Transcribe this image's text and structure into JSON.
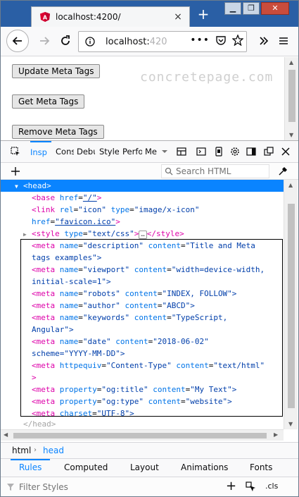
{
  "browser": {
    "tab_title": "localhost:4200/",
    "tab_close": "×",
    "new_tab": "+",
    "url_main": "localhost:",
    "url_faded": "420",
    "window_controls": [
      "▁",
      "❐",
      "✕"
    ],
    "accent": "#0a84ff"
  },
  "page": {
    "buttons": [
      "Update Meta Tags",
      "Get Meta Tags",
      "Remove Meta Tags"
    ],
    "brand_text": "concretepage.com"
  },
  "devtools": {
    "tabs": [
      "Insp",
      "Cons",
      "Debu",
      "Style",
      "Perfo",
      "Me"
    ],
    "search_placeholder": "Search HTML",
    "markup": {
      "head_open": "<head>",
      "head_close": "</head>",
      "base": {
        "tag": "<base",
        "attr": "href",
        "val": "\"/\"",
        "end": ">"
      },
      "link": {
        "tag": "<link",
        "attr1": "rel",
        "val1": "\"icon\"",
        "attr2": "type",
        "val2": "\"image/x-icon\"",
        "attr3": "href",
        "val3": "\"favicon.ico\"",
        "end": ">"
      },
      "style": {
        "tag": "<style",
        "attr": "type",
        "val": "\"text/css\"",
        "end": ">",
        "ellipsis": "…",
        "close": "</style>"
      },
      "meta_lines": [
        {
          "a": "name",
          "v": "\"description\"",
          "b": "content",
          "w": "\"Title and Meta",
          "cont": "tags examples\">"
        },
        {
          "a": "name",
          "v": "\"viewport\"",
          "b": "content",
          "w": "\"width=device-width,",
          "cont": "initial-scale=1\">"
        },
        {
          "a": "name",
          "v": "\"robots\"",
          "b": "content",
          "w": "\"INDEX, FOLLOW\">",
          "cont": ""
        },
        {
          "a": "name",
          "v": "\"author\"",
          "b": "content",
          "w": "\"ABCD\">",
          "cont": ""
        },
        {
          "a": "name",
          "v": "\"keywords\"",
          "b": "content",
          "w": "\"TypeScript,",
          "cont": "Angular\">"
        },
        {
          "a": "name",
          "v": "\"date\"",
          "b": "content",
          "w": "\"2018-06-02\"",
          "cont": "scheme=\"YYYY-MM-DD\">"
        },
        {
          "a": "httpequiv",
          "v": "\"Content-Type\"",
          "b": "content",
          "w": "\"text/html\"",
          "cont": ">"
        },
        {
          "a": "property",
          "v": "\"og:title\"",
          "b": "content",
          "w": "\"My Text\">",
          "cont": ""
        },
        {
          "a": "property",
          "v": "\"og:type\"",
          "b": "content",
          "w": "\"website\">",
          "cont": ""
        },
        {
          "a": "charset",
          "v": "\"UTF-8\">",
          "b": "",
          "w": "",
          "cont": ""
        }
      ],
      "meta_tag": "<meta"
    },
    "breadcrumbs": [
      "html",
      "head"
    ],
    "rules_tabs": [
      "Rules",
      "Computed",
      "Layout",
      "Animations",
      "Fonts"
    ],
    "filter_placeholder": "Filter Styles",
    "cls_label": ".cls",
    "add_label": "+"
  }
}
